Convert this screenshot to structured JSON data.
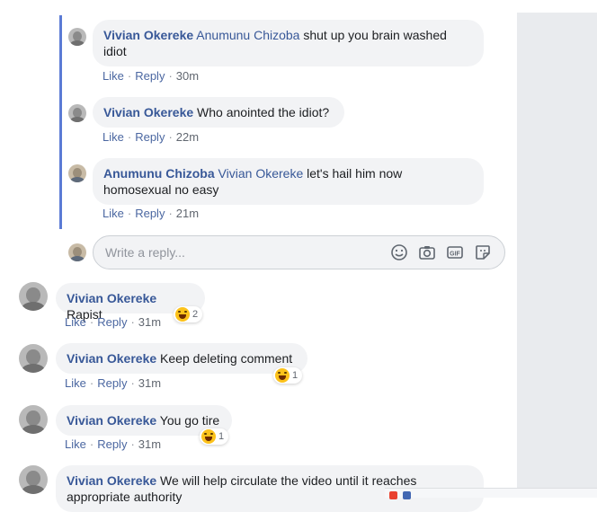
{
  "actions": {
    "like": "Like",
    "reply": "Reply",
    "separator": "·"
  },
  "replies": [
    {
      "author": "Vivian Okereke",
      "mention": "Anumunu Chizoba",
      "text_line1": "shut up you brain washed",
      "text_line2": "idiot",
      "time": "30m"
    },
    {
      "author": "Vivian Okereke",
      "text": "Who anointed the idiot?",
      "time": "22m"
    },
    {
      "author": "Anumunu Chizoba",
      "mention": "Vivian Okereke",
      "text_line1": "let's hail him now",
      "text_line2": "homosexual no easy",
      "time": "21m"
    }
  ],
  "reply_input": {
    "placeholder": "Write a reply..."
  },
  "reply_tools": [
    "emoji-icon",
    "camera-icon",
    "gif-icon",
    "sticker-icon"
  ],
  "comments": [
    {
      "author": "Vivian Okereke",
      "text": "Rapist",
      "time": "31m",
      "reaction": {
        "icon": "haha-icon",
        "count": "2"
      }
    },
    {
      "author": "Vivian Okereke",
      "text": "Keep deleting comment",
      "time": "31m",
      "reaction": {
        "icon": "haha-icon",
        "count": "1"
      }
    },
    {
      "author": "Vivian Okereke",
      "text": "You go tire",
      "time": "31m",
      "reaction": {
        "icon": "haha-icon",
        "count": "1"
      }
    },
    {
      "author": "Vivian Okereke",
      "text": "We will help circulate the video until it reaches",
      "text_line2": "appropriate authority"
    }
  ],
  "colors": {
    "link": "#385898",
    "bubble": "#f2f3f5",
    "thread_line": "#5b7bd5",
    "sidebar": "#e9ebee"
  }
}
